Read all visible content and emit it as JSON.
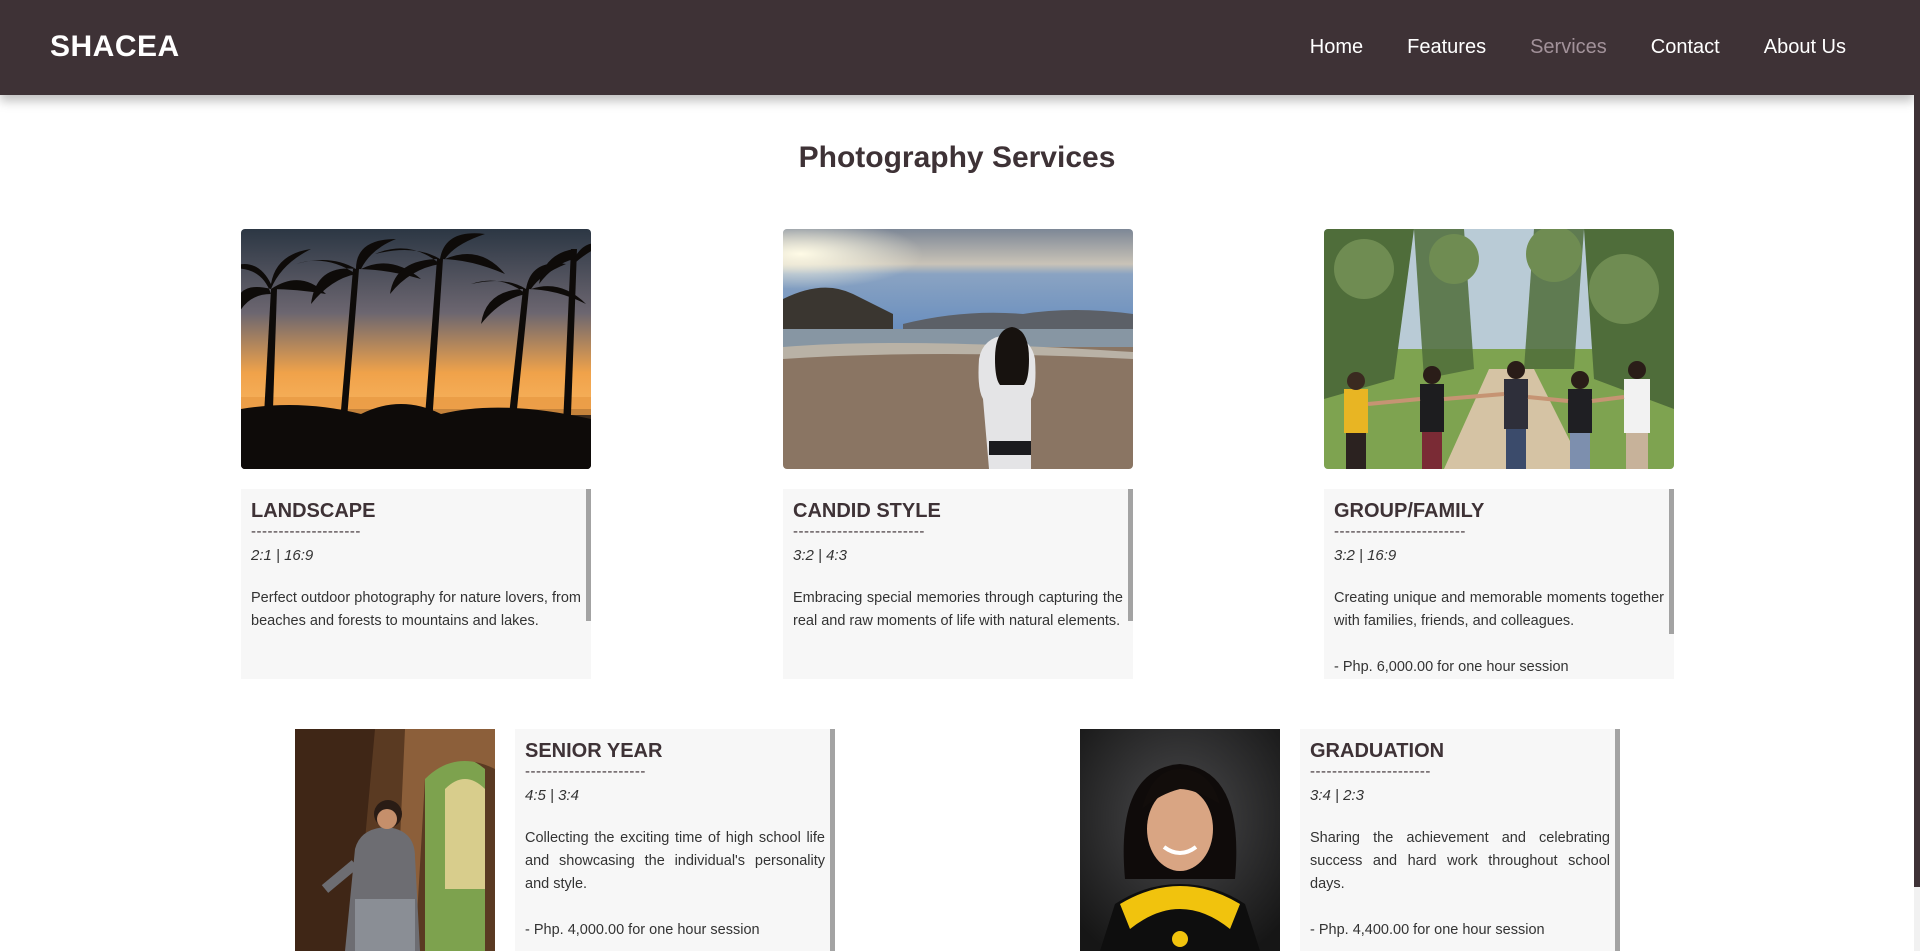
{
  "header": {
    "brand": "SHACEA",
    "nav": [
      "Home",
      "Features",
      "Services",
      "Contact",
      "About Us"
    ],
    "active_nav": "Services"
  },
  "main": {
    "title": "Photography Services"
  },
  "services": [
    {
      "title": "LANDSCAPE",
      "dashes": "--------------------",
      "ratio": "2:1 | 16:9",
      "description": "Perfect outdoor photography for nature lovers, from beaches and forests to mountains and lakes.",
      "price": ""
    },
    {
      "title": "CANDID STYLE",
      "dashes": "------------------------",
      "ratio": "3:2 | 4:3",
      "description": "Embracing special memories through capturing the real and raw moments of life with natural elements.",
      "price": ""
    },
    {
      "title": "GROUP/FAMILY",
      "dashes": "------------------------",
      "ratio": "3:2 | 16:9",
      "description": "Creating unique and memorable moments together with families, friends, and colleagues.",
      "price": "- Php. 6,000.00 for one hour session"
    },
    {
      "title": "SENIOR YEAR",
      "dashes": "----------------------",
      "ratio": "4:5 | 3:4",
      "description": "Collecting the exciting time of high school life and showcasing the individual's personality and style.",
      "price": "- Php. 4,000.00 for one hour session"
    },
    {
      "title": "GRADUATION",
      "dashes": "----------------------",
      "ratio": "3:4 | 2:3",
      "description": "Sharing the achievement and celebrating success and hard work throughout school days.",
      "price": "- Php. 4,400.00 for one hour session"
    }
  ],
  "colors": {
    "header_bg": "#3e3236",
    "nav_active": "#a2929a",
    "card_bg": "#f7f7f7",
    "card_bar": "#a3a3a3"
  }
}
